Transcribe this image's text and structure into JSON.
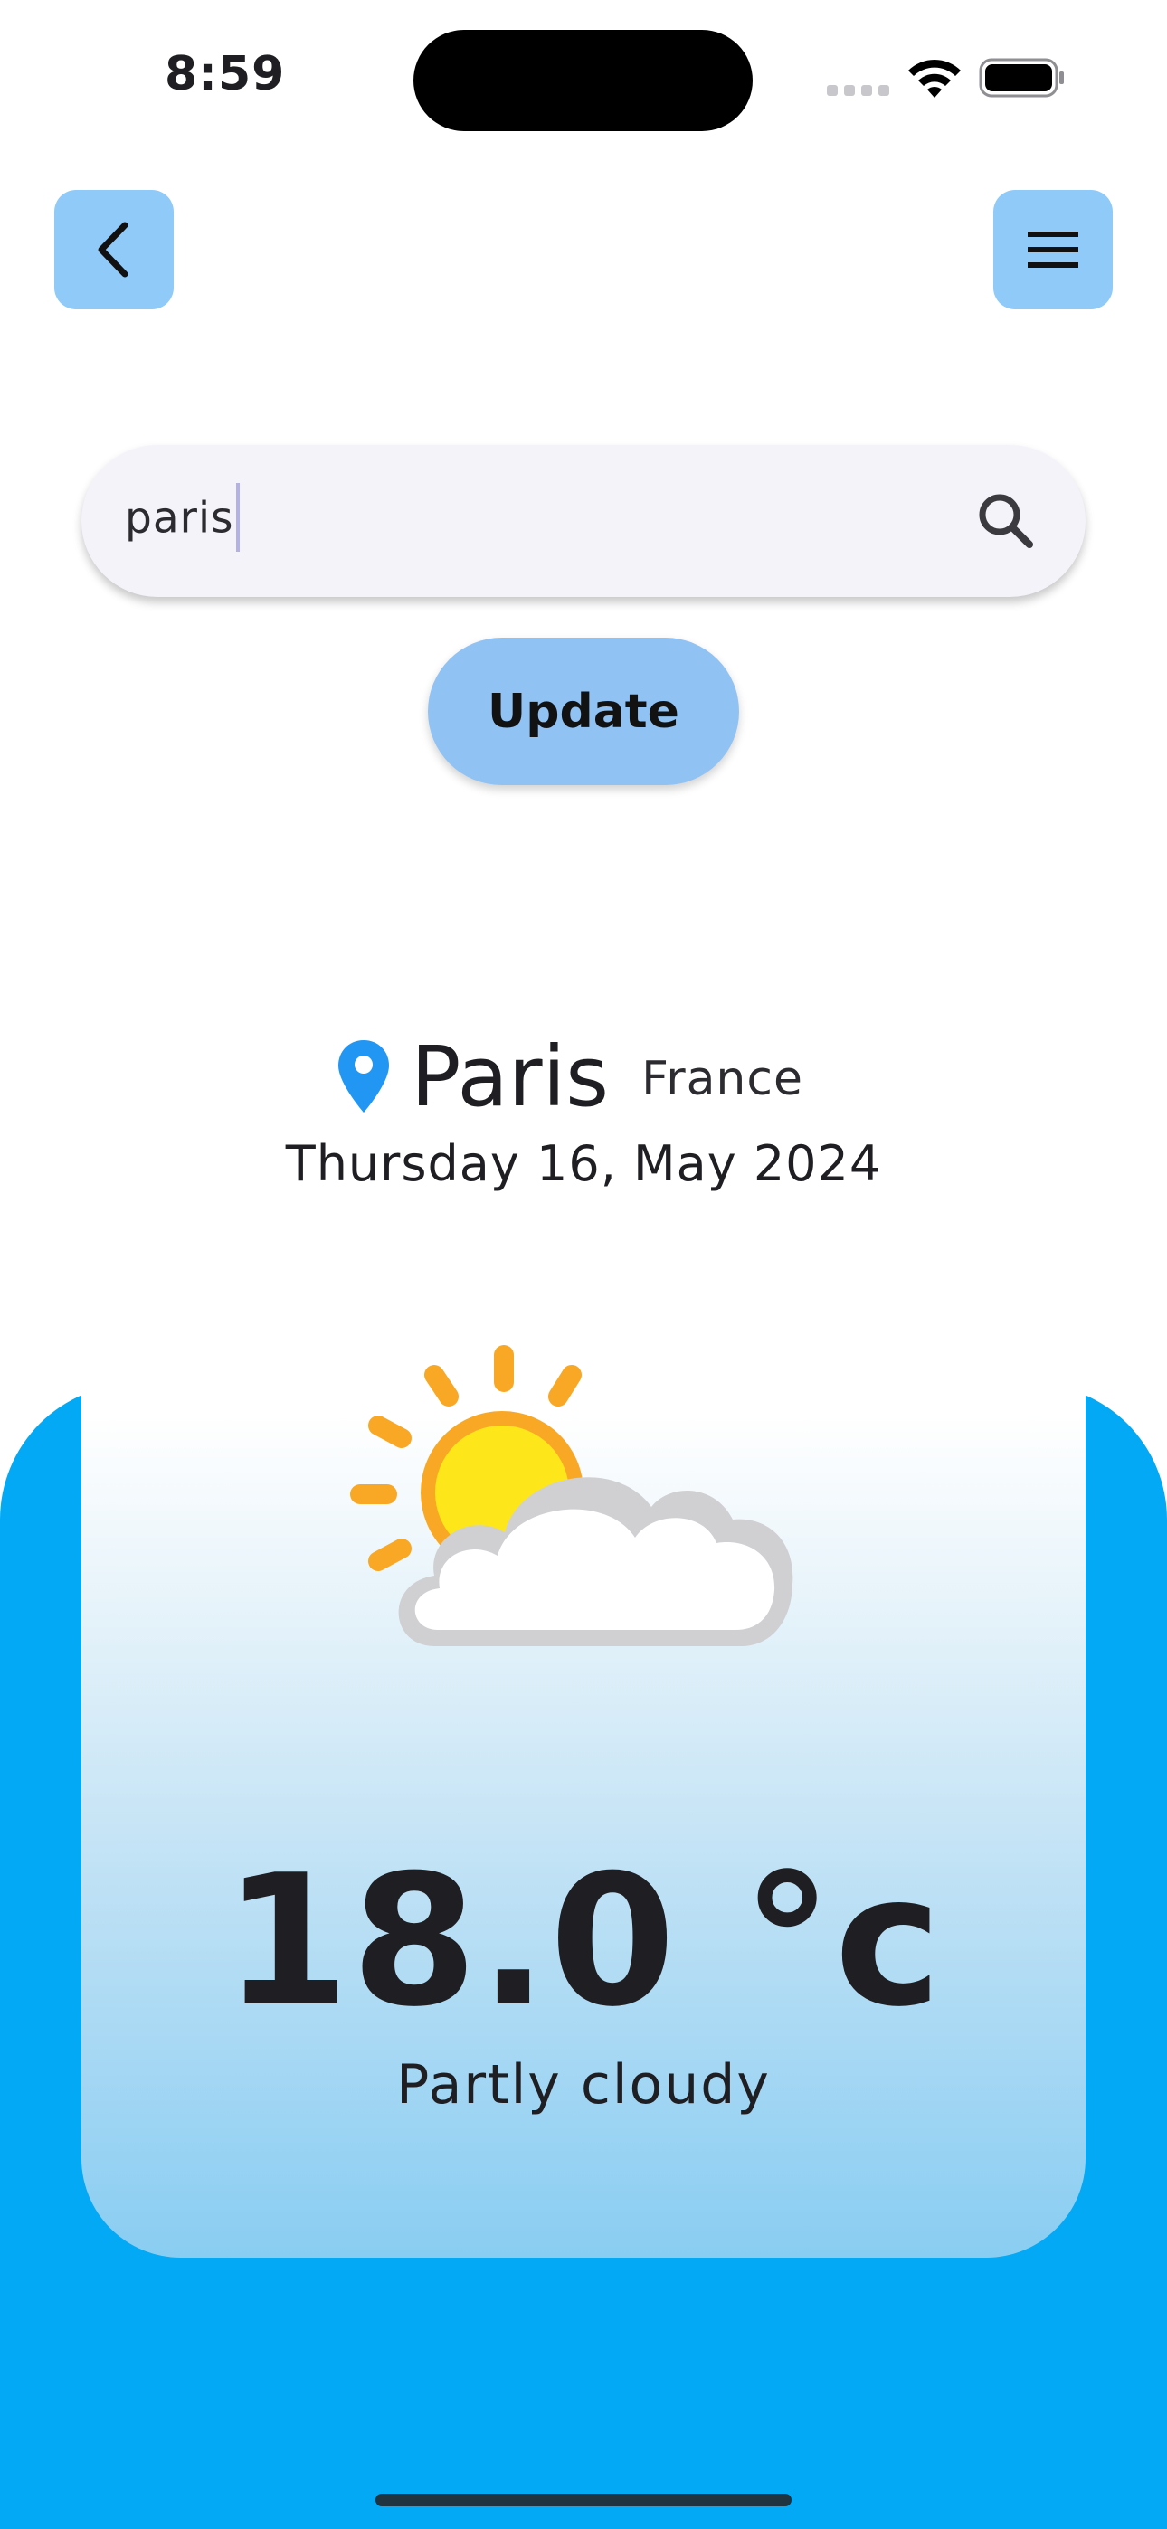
{
  "status_bar": {
    "time": "8:59"
  },
  "nav": {
    "back_icon": "chevron-left-icon",
    "menu_icon": "hamburger-menu-icon"
  },
  "search": {
    "value": "paris",
    "icon": "search-icon"
  },
  "update_button": {
    "label": "Update"
  },
  "location": {
    "city": "Paris",
    "country": "France",
    "date": "Thursday 16, May 2024"
  },
  "weather": {
    "icon": "partly-cloudy-icon",
    "temperature": "18.0 °c",
    "condition": "Partly cloudy"
  },
  "colors": {
    "accent_blue": "#03a9f4",
    "button_blue": "#90caf9",
    "pin_blue": "#2196f3"
  }
}
